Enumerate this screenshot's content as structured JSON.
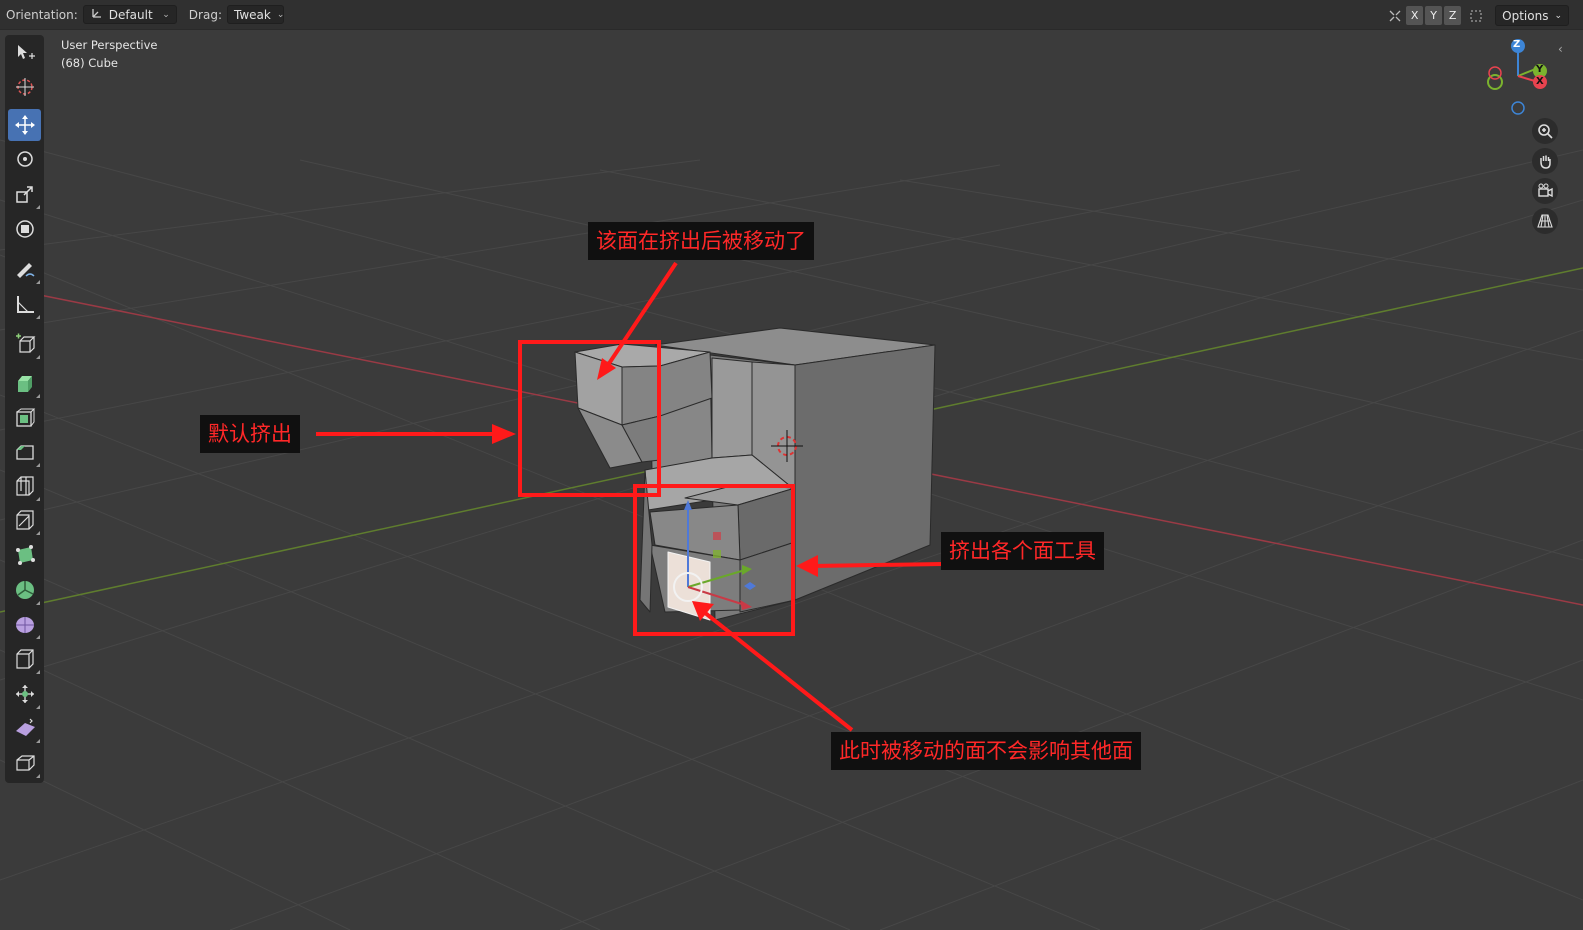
{
  "header": {
    "orientation_label": "Orientation:",
    "orientation_value": "Default",
    "drag_label": "Drag:",
    "drag_value": "Tweak",
    "axis_x": "X",
    "axis_y": "Y",
    "axis_z": "Z",
    "options_label": "Options"
  },
  "viewport": {
    "view_name": "User Perspective",
    "object_info": "(68) Cube"
  },
  "toolbar": {
    "tools": [
      "select-box-icon",
      "cursor-icon",
      "move-icon",
      "rotate-icon",
      "scale-icon",
      "transform-icon",
      "annotate-icon",
      "measure-icon",
      "add-cube-icon",
      "extrude-region-icon",
      "inset-faces-icon",
      "bevel-icon",
      "loop-cut-icon",
      "knife-icon",
      "poly-build-icon",
      "spin-icon",
      "smooth-icon",
      "edge-slide-icon",
      "shrink-fatten-icon",
      "shear-icon",
      "rip-region-icon"
    ],
    "active_tool": "move-icon"
  },
  "gizmo": {
    "z_label": "Z",
    "y_label": "Y",
    "x_label": "X",
    "colors": {
      "x": "#e8434f",
      "y": "#7bb32e",
      "z": "#3d85d6"
    }
  },
  "nav_buttons": [
    "zoom-icon",
    "pan-hand-icon",
    "camera-icon",
    "perspective-grid-icon"
  ],
  "annotations": {
    "top": "该面在挤出后被移动了",
    "left": "默认挤出",
    "right": "挤出各个面工具",
    "bottom": "此时被移动的面不会影响其他面"
  },
  "colors": {
    "viewport_bg": "#3b3b3b",
    "annotation_red": "#ff1a1a",
    "annotation_bg": "#101010",
    "active_tool": "#4772b3"
  }
}
